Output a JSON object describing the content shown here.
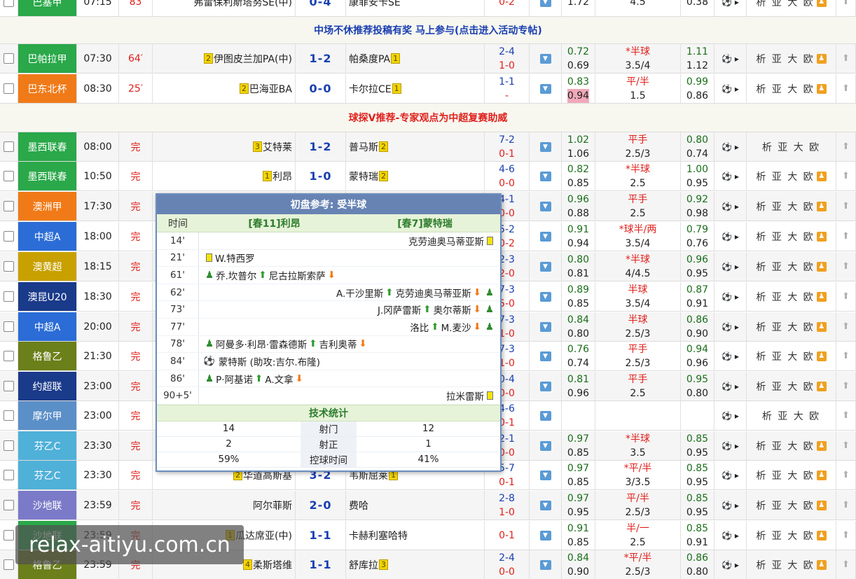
{
  "banners": {
    "b1": {
      "text": "中场不休推荐投稿有奖 马上参与(点击进入活动专帖)",
      "color": "#1a3fb0"
    },
    "b2": {
      "text": "球探V推荐-专家观点为中超复赛助威",
      "color": "#e0201c"
    }
  },
  "matches": [
    {
      "league": "巴塞甲",
      "color": "#2aa84a",
      "time": "07:15",
      "status": "83",
      "home": "弗雷保利斯塔努SE(中)",
      "home_rank": "",
      "score": "0-4",
      "away": "康菲安卡SE",
      "away_rank": "",
      "half1": "",
      "half2": "0-2",
      "o1a": "",
      "o1b": "1.72",
      "hc_a": "",
      "hc_b": "4.5",
      "o2a": "",
      "o2b": "0.38",
      "links": "析 亚 大 欧",
      "user": true
    },
    {
      "league": "巴帕拉甲",
      "color": "#2aa84a",
      "time": "07:30",
      "status": "64′",
      "home": "伊图皮兰加PA(中)",
      "home_rank": "2",
      "score": "1-2",
      "away": "帕桑度PA",
      "away_rank": "1",
      "half1": "2-4",
      "half2": "1-0",
      "o1a": "0.72",
      "o1b": "0.69",
      "hc_a": "*半球",
      "hc_b": "3.5/4",
      "o2a": "1.11",
      "o2b": "1.12",
      "links": "析 亚 大 欧",
      "user": true
    },
    {
      "league": "巴东北杯",
      "color": "#f07a18",
      "time": "08:30",
      "status": "25′",
      "home": "巴海亚BA",
      "home_rank": "2",
      "score": "0-0",
      "away": "卡尔拉CE",
      "away_rank": "1",
      "half1": "1-1",
      "half2": "-",
      "o1a": "0.83",
      "o1b": "0.94",
      "hc_a": "平/半",
      "hc_b": "1.5",
      "o2a": "0.99",
      "o2b": "0.86",
      "links": "析 亚 大 欧",
      "user": true
    },
    {
      "league": "墨西联春",
      "color": "#2aa84a",
      "time": "08:00",
      "status": "完",
      "home": "艾特莱",
      "home_rank": "3",
      "score": "1-2",
      "away": "普马斯",
      "away_rank": "2",
      "half1": "7-2",
      "half2": "0-1",
      "o1a": "1.02",
      "o1b": "1.06",
      "hc_a": "平手",
      "hc_b": "2.5/3",
      "o2a": "0.80",
      "o2b": "0.74",
      "links": "析 亚 大 欧",
      "user": false
    },
    {
      "league": "墨西联春",
      "color": "#2aa84a",
      "time": "10:50",
      "status": "完",
      "home": "利昂",
      "home_rank": "1",
      "score": "1-0",
      "away": "蒙特瑞",
      "away_rank": "2",
      "half1": "4-6",
      "half2": "0-0",
      "o1a": "0.82",
      "o1b": "0.85",
      "hc_a": "*半球",
      "hc_b": "2.5",
      "o2a": "1.00",
      "o2b": "0.95",
      "links": "析 亚 大 欧",
      "user": true
    },
    {
      "league": "澳洲甲",
      "color": "#f07a18",
      "time": "17:30",
      "status": "完",
      "home": "",
      "home_rank": "",
      "score": "",
      "away": "",
      "away_rank": "",
      "half1": "4-1",
      "half2": "0-0",
      "o1a": "0.96",
      "o1b": "0.88",
      "hc_a": "平手",
      "hc_b": "2.5",
      "o2a": "0.92",
      "o2b": "0.98",
      "links": "析 亚 大 欧",
      "user": true
    },
    {
      "league": "中超A",
      "color": "#2b6cd6",
      "time": "18:00",
      "status": "完",
      "home": "",
      "home_rank": "",
      "score": "",
      "away": "",
      "away_rank": "",
      "half1": "5-2",
      "half2": "0-2",
      "o1a": "0.91",
      "o1b": "0.94",
      "hc_a": "*球半/两",
      "hc_b": "3.5/4",
      "o2a": "0.79",
      "o2b": "0.76",
      "links": "析 亚 大 欧",
      "user": true
    },
    {
      "league": "澳黄超",
      "color": "#c8a000",
      "time": "18:15",
      "status": "完",
      "home": "",
      "home_rank": "",
      "score": "",
      "away": "",
      "away_rank": "",
      "half1": "2-3",
      "half2": "2-0",
      "o1a": "0.80",
      "o1b": "0.81",
      "hc_a": "*半球",
      "hc_b": "4/4.5",
      "o2a": "0.96",
      "o2b": "0.95",
      "links": "析 亚 大 欧",
      "user": true
    },
    {
      "league": "澳昆U20",
      "color": "#1a3a8a",
      "time": "18:30",
      "status": "完",
      "home": "",
      "home_rank": "",
      "score": "",
      "away": "",
      "away_rank": "",
      "half1": "7-3",
      "half2": "5-0",
      "o1a": "0.89",
      "o1b": "0.85",
      "hc_a": "半球",
      "hc_b": "3.5/4",
      "o2a": "0.87",
      "o2b": "0.91",
      "links": "析 亚 大 欧",
      "user": true
    },
    {
      "league": "中超A",
      "color": "#2b6cd6",
      "time": "20:00",
      "status": "完",
      "home": "",
      "home_rank": "",
      "score": "",
      "away": "",
      "away_rank": "",
      "half1": "7-3",
      "half2": "1-0",
      "o1a": "0.84",
      "o1b": "0.80",
      "hc_a": "半球",
      "hc_b": "2.5/3",
      "o2a": "0.86",
      "o2b": "0.90",
      "links": "析 亚 大 欧",
      "user": true
    },
    {
      "league": "格鲁乙",
      "color": "#6b7f1a",
      "time": "21:30",
      "status": "完",
      "home": "",
      "home_rank": "",
      "score": "",
      "away": "",
      "away_rank": "",
      "half1": "7-3",
      "half2": "1-0",
      "o1a": "0.76",
      "o1b": "0.74",
      "hc_a": "平手",
      "hc_b": "2.5/3",
      "o2a": "0.94",
      "o2b": "0.96",
      "links": "析 亚 大 欧",
      "user": true
    },
    {
      "league": "约超联",
      "color": "#1a3a8a",
      "time": "23:00",
      "status": "完",
      "home": "",
      "home_rank": "",
      "score": "",
      "away": "",
      "away_rank": "",
      "half1": "0-4",
      "half2": "0-0",
      "o1a": "0.81",
      "o1b": "0.96",
      "hc_a": "平手",
      "hc_b": "2.5",
      "o2a": "0.95",
      "o2b": "0.80",
      "links": "析 亚 大 欧",
      "user": true
    },
    {
      "league": "摩尔甲",
      "color": "#5b8fc8",
      "time": "23:00",
      "status": "完",
      "home": "",
      "home_rank": "",
      "score": "",
      "away": "",
      "away_rank": "",
      "half1": "4-6",
      "half2": "0-1",
      "o1a": "",
      "o1b": "",
      "hc_a": "",
      "hc_b": "",
      "o2a": "",
      "o2b": "",
      "links": "析 亚 大 欧",
      "user": false
    },
    {
      "league": "芬乙C",
      "color": "#4fb0d8",
      "time": "23:30",
      "status": "完",
      "home": "",
      "home_rank": "",
      "score": "",
      "away": "",
      "away_rank": "",
      "half1": "2-1",
      "half2": "0-0",
      "o1a": "0.97",
      "o1b": "0.85",
      "hc_a": "*半球",
      "hc_b": "3.5",
      "o2a": "0.85",
      "o2b": "0.95",
      "links": "析 亚 大 欧",
      "user": true
    },
    {
      "league": "芬乙C",
      "color": "#4fb0d8",
      "time": "23:30",
      "status": "完",
      "home": "华道高斯基",
      "home_rank": "2",
      "score": "3-2",
      "away": "韦斯屈莱",
      "away_rank": "1",
      "half1": "5-7",
      "half2": "0-1",
      "o1a": "0.97",
      "o1b": "0.85",
      "hc_a": "*平/半",
      "hc_b": "3/3.5",
      "o2a": "0.85",
      "o2b": "0.95",
      "links": "析 亚 大 欧",
      "user": true
    },
    {
      "league": "沙地联",
      "color": "#7a7ac8",
      "time": "23:59",
      "status": "完",
      "home": "阿尔菲斯",
      "home_rank": "",
      "score": "2-0",
      "away": "费哈",
      "away_rank": "",
      "half1": "2-8",
      "half2": "1-0",
      "o1a": "0.97",
      "o1b": "0.95",
      "hc_a": "平/半",
      "hc_b": "2.5/3",
      "o2a": "0.85",
      "o2b": "0.95",
      "links": "析 亚 大 欧",
      "user": true
    },
    {
      "league": "沙地联",
      "color": "#2aa84a",
      "time": "23:59",
      "status": "完",
      "home": "瓜达席亚(中)",
      "home_rank": "1",
      "score": "1-1",
      "away": "卡赫利塞哈特",
      "away_rank": "",
      "half1": "",
      "half2": "0-1",
      "o1a": "0.91",
      "o1b": "0.85",
      "hc_a": "半/一",
      "hc_b": "2.5",
      "o2a": "0.85",
      "o2b": "0.91",
      "links": "析 亚 大 欧",
      "user": true
    },
    {
      "league": "格鲁乙",
      "color": "#6b7f1a",
      "time": "23:59",
      "status": "完",
      "home": "柔斯塔维",
      "home_rank": "4",
      "score": "1-1",
      "away": "舒库拉",
      "away_rank": "3",
      "half1": "2-4",
      "half2": "0-0",
      "o1a": "0.84",
      "o1b": "0.90",
      "hc_a": "*平/半",
      "hc_b": "2.5/3",
      "o2a": "0.86",
      "o2b": "0.80",
      "links": "析 亚 大 欧",
      "user": true
    }
  ],
  "popup": {
    "title": "初盘参考: 受半球",
    "col_time": "时间",
    "home_team": "[春11]利昂",
    "away_team": "[春7]蒙特瑞",
    "events": [
      {
        "time": "14'",
        "side": "away",
        "text": "克劳迪奥马蒂亚斯",
        "type": "yellow"
      },
      {
        "time": "21'",
        "side": "home",
        "text": "W.特西罗",
        "type": "yellow"
      },
      {
        "time": "61'",
        "side": "home",
        "text": "乔.坎普尔",
        "out": "尼古拉斯索萨",
        "type": "sub"
      },
      {
        "time": "62'",
        "side": "away",
        "text": "A.干沙里斯",
        "out": "克劳迪奥马蒂亚斯",
        "type": "sub"
      },
      {
        "time": "73'",
        "side": "away",
        "text": "J.冈萨雷斯",
        "out": "奥尔蒂斯",
        "type": "sub"
      },
      {
        "time": "77'",
        "side": "away",
        "text": "洛比",
        "out": "M.麦沙",
        "type": "sub"
      },
      {
        "time": "78'",
        "side": "home",
        "text": "阿曼多·利昂·雷森德斯",
        "out": "吉利奥蒂",
        "type": "sub"
      },
      {
        "time": "84'",
        "side": "home",
        "text": "蒙特斯 (助攻:吉尔.布隆)",
        "type": "goal"
      },
      {
        "time": "86'",
        "side": "home",
        "text": "P·阿基诺",
        "out": "A.文拿",
        "type": "sub"
      },
      {
        "time": "90+5'",
        "side": "away",
        "text": "拉米雷斯",
        "type": "yellow"
      }
    ],
    "stats_title": "技术统计",
    "stats": [
      {
        "home": "14",
        "label": "射门",
        "away": "12"
      },
      {
        "home": "2",
        "label": "射正",
        "away": "1"
      },
      {
        "home": "59%",
        "label": "控球时间",
        "away": "41%"
      }
    ]
  },
  "watermark": "relax-aitiyu.com.cn"
}
